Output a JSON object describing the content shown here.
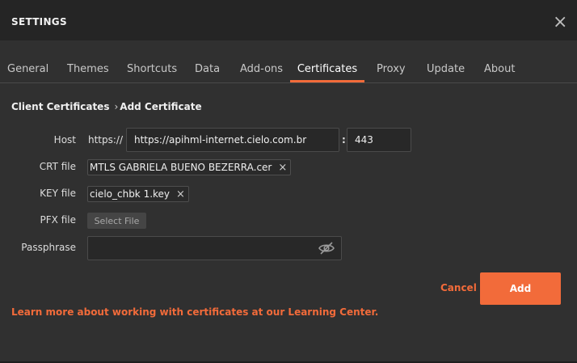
{
  "dialog": {
    "title": "SETTINGS",
    "close_glyph": "×"
  },
  "tabs": [
    {
      "label": "General"
    },
    {
      "label": "Themes"
    },
    {
      "label": "Shortcuts"
    },
    {
      "label": "Data"
    },
    {
      "label": "Add-ons"
    },
    {
      "label": "Certificates",
      "active": true
    },
    {
      "label": "Proxy"
    },
    {
      "label": "Update"
    },
    {
      "label": "About"
    }
  ],
  "breadcrumb": {
    "root": "Client Certificates",
    "separator": "›",
    "current": "Add Certificate"
  },
  "form": {
    "host": {
      "label": "Host",
      "prefix": "https://",
      "value": "https://apihml-internet.cielo.com.br",
      "colon": ":",
      "port": "443"
    },
    "crt": {
      "label": "CRT file",
      "filename": "MTLS GABRIELA BUENO BEZERRA.cer"
    },
    "key": {
      "label": "KEY file",
      "filename": "cielo_chbk 1.key"
    },
    "pfx": {
      "label": "PFX file",
      "button": "Select File"
    },
    "passphrase": {
      "label": "Passphrase",
      "value": ""
    },
    "remove_glyph": "×"
  },
  "actions": {
    "cancel": "Cancel",
    "add": "Add"
  },
  "footer": {
    "learn_more": "Learn more about working with certificates at our Learning Center."
  },
  "colors": {
    "accent": "#f26b3a",
    "background": "#303030",
    "header": "#252525"
  },
  "icons": {
    "close": "close-icon",
    "remove": "close-icon",
    "visibility": "eye-off-icon"
  }
}
